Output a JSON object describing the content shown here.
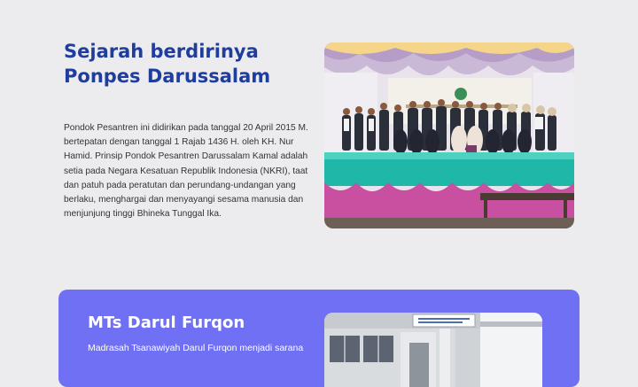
{
  "history": {
    "title": "Sejarah berdirinya Ponpes Darussalam",
    "text": "Pondok Pesantren ini didirikan pada tanggal 20 April 2015 M. bertepatan dengan tanggal 1 Rajab 1436 H. oleh KH. Nur Hamid. Prinsip Pondok Pesantren Darussalam Kamal adalah setia pada Negara Kesatuan Republik Indonesia (NKRI), taat dan patuh pada peratutan dan perundang-undangan yang berlaku, menghargai dan menyayangi sesama manusia dan menjunjung tinggi Bhineka Tunggal Ika.",
    "photo": "group photo of students and teachers on a stage"
  },
  "mts": {
    "title": "MTs Darul Furqon",
    "text": "Madrasah Tsanawiyah Darul Furqon menjadi sarana",
    "photo": "school building exterior"
  },
  "colors": {
    "page_background": "#ececee",
    "heading_blue": "#1f3d9c",
    "card_purple": "#7070f5",
    "stage_teal": "#1fb8a8",
    "stage_pink": "#c94fa0"
  }
}
